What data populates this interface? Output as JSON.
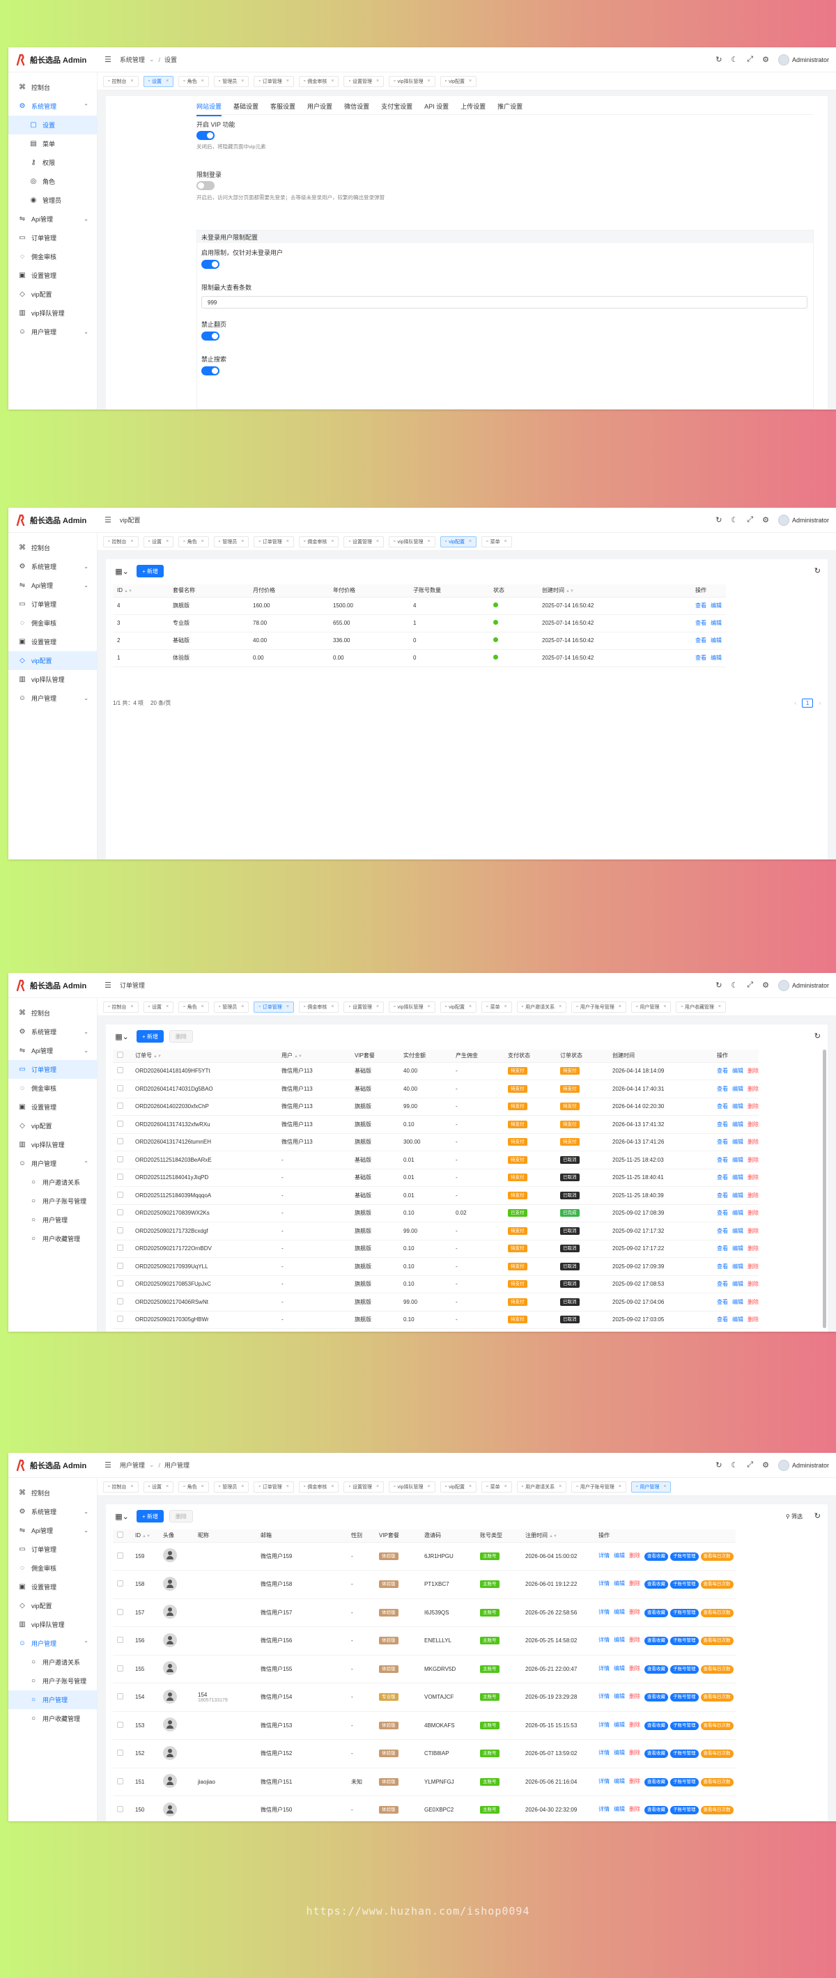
{
  "app": {
    "brand": "船长选品 Admin",
    "user": "Administrator"
  },
  "screens": [
    {
      "breadcrumb": [
        "系统管理",
        "设置"
      ],
      "tabs": [
        {
          "label": "控制台"
        },
        {
          "label": "设置",
          "active": true
        },
        {
          "label": "角色"
        },
        {
          "label": "管理员"
        },
        {
          "label": "订单管理"
        },
        {
          "label": "佣金审核"
        },
        {
          "label": "设置管理"
        },
        {
          "label": "vip择队管理"
        },
        {
          "label": "vip配置"
        }
      ],
      "sidebar": [
        {
          "label": "控制台",
          "icon": "dashboard-icon"
        },
        {
          "label": "系统管理",
          "icon": "gear-icon",
          "open": true,
          "group": true
        },
        {
          "label": "设置",
          "sub": true,
          "active": true
        },
        {
          "label": "菜单",
          "sub": true
        },
        {
          "label": "权限",
          "sub": true
        },
        {
          "label": "角色",
          "sub": true
        },
        {
          "label": "管理员",
          "sub": true
        },
        {
          "label": "Api管理",
          "icon": "api-icon",
          "arrow": true
        },
        {
          "label": "订单管理",
          "icon": "order-icon"
        },
        {
          "label": "佣金审核",
          "icon": "commission-icon"
        },
        {
          "label": "设置管理",
          "icon": "settings-icon"
        },
        {
          "label": "vip配置",
          "icon": "vip-icon"
        },
        {
          "label": "vip择队管理",
          "icon": "team-icon"
        },
        {
          "label": "用户管理",
          "icon": "user-icon",
          "arrow": true
        }
      ],
      "settings": {
        "tabs": [
          "网站设置",
          "基础设置",
          "客服设置",
          "用户设置",
          "微信设置",
          "支付宝设置",
          "API 设置",
          "上传设置",
          "推广设置"
        ],
        "vip_label": "开启 VIP 功能",
        "vip_desc": "关闭后，将隐藏页面中vip元素",
        "login_label": "限制登录",
        "login_desc": "开启后，访问大部分页面都需要先登录；去等级未登录用户，较繁的确出登录弹窗",
        "guest_title": "未登录用户限制配置",
        "guest_enable_label": "启用限制，仅针对未登录用户",
        "max_views_label": "限制最大查看条数",
        "max_views_value": "999",
        "no_page_label": "禁止翻页",
        "no_search_label": "禁止搜索"
      }
    },
    {
      "breadcrumb": [
        "vip配置"
      ],
      "tabs": [
        {
          "label": "控制台"
        },
        {
          "label": "设置"
        },
        {
          "label": "角色"
        },
        {
          "label": "管理员"
        },
        {
          "label": "订单管理"
        },
        {
          "label": "佣金审核"
        },
        {
          "label": "设置管理"
        },
        {
          "label": "vip择队管理"
        },
        {
          "label": "vip配置",
          "active": true
        },
        {
          "label": "菜单"
        }
      ],
      "sidebar": [
        {
          "label": "控制台",
          "icon": "dashboard-icon"
        },
        {
          "label": "系统管理",
          "icon": "gear-icon",
          "arrow": true
        },
        {
          "label": "Api管理",
          "icon": "api-icon",
          "arrow": true
        },
        {
          "label": "订单管理",
          "icon": "order-icon"
        },
        {
          "label": "佣金审核",
          "icon": "commission-icon"
        },
        {
          "label": "设置管理",
          "icon": "settings-icon"
        },
        {
          "label": "vip配置",
          "icon": "vip-icon",
          "active": true
        },
        {
          "label": "vip择队管理",
          "icon": "team-icon"
        },
        {
          "label": "用户管理",
          "icon": "user-icon",
          "arrow": true
        }
      ],
      "toolbar": {
        "add": "+ 新增"
      },
      "columns": [
        "ID",
        "套餐名称",
        "月付价格",
        "年付价格",
        "子账号数量",
        "状态",
        "创建时间",
        "操作"
      ],
      "rows": [
        [
          "4",
          "旗舰版",
          "160.00",
          "1500.00",
          "4",
          "",
          "2025-07-14 16:50:42"
        ],
        [
          "3",
          "专业版",
          "78.00",
          "655.00",
          "1",
          "",
          "2025-07-14 16:50:42"
        ],
        [
          "2",
          "基础版",
          "40.00",
          "336.00",
          "0",
          "",
          "2025-07-14 16:50:42"
        ],
        [
          "1",
          "体验版",
          "0.00",
          "0.00",
          "0",
          "",
          "2025-07-14 16:50:42"
        ]
      ],
      "actions": [
        "查看",
        "编辑"
      ],
      "pager": {
        "total": "1/1 共：4 项",
        "size": "20 条/页",
        "page": "1"
      }
    },
    {
      "breadcrumb": [
        "订单管理"
      ],
      "tabs": [
        {
          "label": "控制台"
        },
        {
          "label": "设置"
        },
        {
          "label": "角色"
        },
        {
          "label": "管理员"
        },
        {
          "label": "订单管理",
          "active": true
        },
        {
          "label": "佣金审核"
        },
        {
          "label": "设置管理"
        },
        {
          "label": "vip择队管理"
        },
        {
          "label": "vip配置"
        },
        {
          "label": "菜单"
        },
        {
          "label": "用户邀请关系"
        },
        {
          "label": "用户子账号管理"
        },
        {
          "label": "用户管理"
        },
        {
          "label": "用户收藏管理"
        }
      ],
      "sidebar": [
        {
          "label": "控制台",
          "icon": "dashboard-icon"
        },
        {
          "label": "系统管理",
          "icon": "gear-icon",
          "arrow": true
        },
        {
          "label": "Api管理",
          "icon": "api-icon",
          "arrow": true
        },
        {
          "label": "订单管理",
          "icon": "order-icon",
          "active": true
        },
        {
          "label": "佣金审核",
          "icon": "commission-icon"
        },
        {
          "label": "设置管理",
          "icon": "settings-icon"
        },
        {
          "label": "vip配置",
          "icon": "vip-icon"
        },
        {
          "label": "vip择队管理",
          "icon": "team-icon"
        },
        {
          "label": "用户管理",
          "icon": "user-icon",
          "open": true
        },
        {
          "label": "用户邀请关系",
          "sub": true
        },
        {
          "label": "用户子账号管理",
          "sub": true
        },
        {
          "label": "用户管理",
          "sub": true
        },
        {
          "label": "用户收藏管理",
          "sub": true
        }
      ],
      "toolbar": {
        "add": "+ 新增",
        "del": "删除"
      },
      "columns": [
        "订单号",
        "用户",
        "VIP套餐",
        "实付金额",
        "产生佣金",
        "支付状态",
        "订单状态",
        "创建时间",
        "操作"
      ],
      "rows": [
        [
          "ORD20260414181409HF5YTt",
          "微信用户113",
          "基础版",
          "40.00",
          "-",
          "待支付",
          "待支付",
          "2026-04-14 18:14:09"
        ],
        [
          "ORD20260414174031Dg5BAO",
          "微信用户113",
          "基础版",
          "40.00",
          "-",
          "待支付",
          "待支付",
          "2026-04-14 17:40:31"
        ],
        [
          "ORD20260414022030xfxChP",
          "微信用户113",
          "旗舰版",
          "99.00",
          "-",
          "待支付",
          "待支付",
          "2026-04-14 02:20:30"
        ],
        [
          "ORD20260413174132xfwRXu",
          "微信用户113",
          "旗舰版",
          "0.10",
          "-",
          "待支付",
          "待支付",
          "2026-04-13 17:41:32"
        ],
        [
          "ORD20260413174126tumnEH",
          "微信用户113",
          "旗舰版",
          "300.00",
          "-",
          "待支付",
          "待支付",
          "2026-04-13 17:41:26"
        ],
        [
          "ORD20251125184203BeARxE",
          "-",
          "基础版",
          "0.01",
          "-",
          "待支付",
          "已取消",
          "2025-11-25 18:42:03"
        ],
        [
          "ORD20251125184041yJIqPD",
          "-",
          "基础版",
          "0.01",
          "-",
          "待支付",
          "已取消",
          "2025-11-25 18:40:41"
        ],
        [
          "ORD20251125184039MqqqoA",
          "-",
          "基础版",
          "0.01",
          "-",
          "待支付",
          "已取消",
          "2025-11-25 18:40:39"
        ],
        [
          "ORD20250902170839WX2Ks",
          "-",
          "旗舰版",
          "0.10",
          "0.02",
          "已支付",
          "已完成",
          "2025-09-02 17:08:39"
        ],
        [
          "ORD20250902171732Bcxdgf",
          "-",
          "旗舰版",
          "99.00",
          "-",
          "待支付",
          "已取消",
          "2025-09-02 17:17:32"
        ],
        [
          "ORD20250902171722OrnBDV",
          "-",
          "旗舰版",
          "0.10",
          "-",
          "待支付",
          "已取消",
          "2025-09-02 17:17:22"
        ],
        [
          "ORD20250902170939UqYLL",
          "-",
          "旗舰版",
          "0.10",
          "-",
          "待支付",
          "已取消",
          "2025-09-02 17:09:39"
        ],
        [
          "ORD20250902170853FUpJxC",
          "-",
          "旗舰版",
          "0.10",
          "-",
          "待支付",
          "已取消",
          "2025-09-02 17:08:53"
        ],
        [
          "ORD20250902170406RSwNt",
          "-",
          "旗舰版",
          "99.00",
          "-",
          "待支付",
          "已取消",
          "2025-09-02 17:04:06"
        ],
        [
          "ORD20250902170305gHBWr",
          "-",
          "旗舰版",
          "0.10",
          "-",
          "待支付",
          "已取消",
          "2025-09-02 17:03:05"
        ]
      ],
      "actions": [
        "查看",
        "编辑",
        "删除"
      ]
    },
    {
      "breadcrumb": [
        "用户管理",
        "用户管理"
      ],
      "tabs": [
        {
          "label": "控制台"
        },
        {
          "label": "设置"
        },
        {
          "label": "角色"
        },
        {
          "label": "管理员"
        },
        {
          "label": "订单管理"
        },
        {
          "label": "佣金审核"
        },
        {
          "label": "设置管理"
        },
        {
          "label": "vip择队管理"
        },
        {
          "label": "vip配置"
        },
        {
          "label": "菜单"
        },
        {
          "label": "用户邀请关系"
        },
        {
          "label": "用户子账号管理"
        },
        {
          "label": "用户管理",
          "active": true
        }
      ],
      "sidebar": [
        {
          "label": "控制台",
          "icon": "dashboard-icon"
        },
        {
          "label": "系统管理",
          "icon": "gear-icon",
          "arrow": true
        },
        {
          "label": "Api管理",
          "icon": "api-icon",
          "arrow": true
        },
        {
          "label": "订单管理",
          "icon": "order-icon"
        },
        {
          "label": "佣金审核",
          "icon": "commission-icon"
        },
        {
          "label": "设置管理",
          "icon": "settings-icon"
        },
        {
          "label": "vip配置",
          "icon": "vip-icon"
        },
        {
          "label": "vip择队管理",
          "icon": "team-icon"
        },
        {
          "label": "用户管理",
          "icon": "user-icon",
          "open": true,
          "group": true
        },
        {
          "label": "用户邀请关系",
          "sub": true
        },
        {
          "label": "用户子账号管理",
          "sub": true
        },
        {
          "label": "用户管理",
          "sub": true,
          "active": true
        },
        {
          "label": "用户收藏管理",
          "sub": true
        }
      ],
      "toolbar": {
        "add": "+ 新增",
        "del": "删除",
        "filter": "筛选"
      },
      "columns": [
        "ID",
        "头像",
        "昵称",
        "邮箱",
        "性别",
        "VIP套餐",
        "邀请码",
        "账号类型",
        "注册时间",
        "操作"
      ],
      "rows": [
        [
          "159",
          "",
          "",
          "微信用户159",
          "-",
          "体验版",
          "6JR1HPGU",
          "主账号",
          "2026-06-04 15:00:02"
        ],
        [
          "158",
          "",
          "",
          "微信用户158",
          "-",
          "体验版",
          "PT1XBC7",
          "主账号",
          "2026-06-01 19:12:22"
        ],
        [
          "157",
          "",
          "",
          "微信用户157",
          "-",
          "体验版",
          "I6J539QS",
          "主账号",
          "2026-05-26 22:58:56"
        ],
        [
          "156",
          "",
          "",
          "微信用户156",
          "-",
          "体验版",
          "ENELLLYL",
          "主账号",
          "2026-05-25 14:58:02"
        ],
        [
          "155",
          "",
          "",
          "微信用户155",
          "-",
          "体验版",
          "MKGDRV5D",
          "主账号",
          "2026-05-21 22:00:47"
        ],
        [
          "154",
          "",
          "154|18057133179",
          "微信用户154",
          "-",
          "专业版",
          "VOMTAJCF",
          "主账号",
          "2026-05-19 23:29:28"
        ],
        [
          "153",
          "",
          "",
          "微信用户153",
          "-",
          "体验版",
          "4BMOKAFS",
          "主账号",
          "2026-05-15 15:15:53"
        ],
        [
          "152",
          "",
          "",
          "微信用户152",
          "-",
          "体验版",
          "CTIB8IAP",
          "主账号",
          "2026-05-07 13:59:02"
        ],
        [
          "151",
          "",
          "jiaojiao",
          "微信用户151",
          "未知",
          "体验版",
          "YLMPNFGJ",
          "主账号",
          "2026-05-06 21:16:04"
        ],
        [
          "150",
          "",
          "",
          "微信用户150",
          "-",
          "体验版",
          "GE0XBPC2",
          "主账号",
          "2026-04-30 22:32:09"
        ]
      ],
      "actions": [
        "详情",
        "编辑",
        "删除"
      ],
      "pill_actions": [
        "查看收藏",
        "子账号管理",
        "查看每日次数"
      ]
    }
  ],
  "watermark": "https://www.huzhan.com/ishop0094"
}
